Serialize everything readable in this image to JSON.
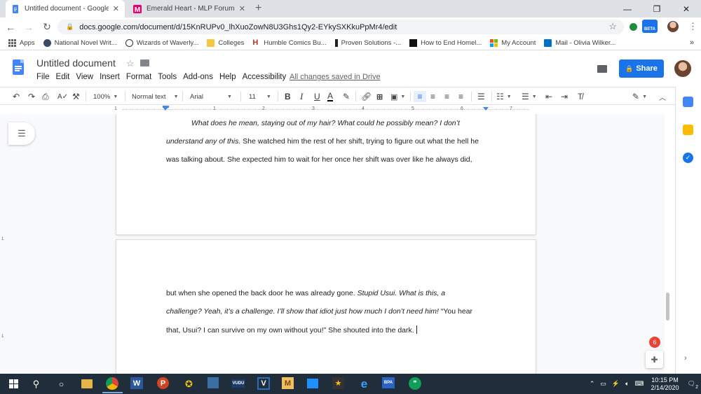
{
  "browser": {
    "tabs": [
      {
        "title": "Untitled document - Google Doc",
        "close": "✕"
      },
      {
        "title": "Emerald Heart - MLP Forums",
        "close": "✕"
      }
    ],
    "new_tab": "+",
    "window_controls": [
      "—",
      "❐",
      "✕"
    ],
    "url": "docs.google.com/document/d/15KnRUPv0_lhXuoZowN8U3Ghs1Qy2-EYkySXKkuPpMr4/edit",
    "extension_label": "BETA",
    "bookmarks": [
      "Apps",
      "National Novel Writ...",
      "Wizards of Waverly...",
      "Colleges",
      "Humble Comics Bu...",
      "Proven Solutions -...",
      "How to End Homel...",
      "My Account",
      "Mail - Olivia Wilker..."
    ],
    "bookmarks_more": "»",
    "colors": {
      "accent": "#1a73e8",
      "docs_blue": "#4285f4",
      "taskbar": "#1f2e3a"
    }
  },
  "docs": {
    "title": "Untitled document",
    "menus": [
      "File",
      "Edit",
      "View",
      "Insert",
      "Format",
      "Tools",
      "Add-ons",
      "Help",
      "Accessibility"
    ],
    "save_status": "All changes saved in Drive",
    "share_label": "Share",
    "toolbar": {
      "zoom": "100%",
      "style": "Normal text",
      "font": "Arial",
      "size": "11",
      "bold": "B",
      "italic": "I",
      "underline": "U",
      "text_color": "A"
    },
    "ruler_ticks": [
      "1",
      "1",
      "2",
      "3",
      "4",
      "5",
      "6",
      "7"
    ],
    "vertical_ruler": [
      "1",
      "1"
    ]
  },
  "document": {
    "page1_lines": [
      [
        {
          "t": "What does he mean, staying out of my hair? What could he possibly mean? I don’t",
          "i": true
        }
      ],
      [
        {
          "t": "understand any of this.",
          "i": true
        },
        {
          "t": " She watched him the rest of her shift, trying to figure out what the hell he",
          "i": false
        }
      ],
      [
        {
          "t": "was talking about. She expected him to wait for her once her shift was over like he always did,",
          "i": false
        }
      ]
    ],
    "page2_lines": [
      [
        {
          "t": "but when she opened the back door he was already gone. ",
          "i": false
        },
        {
          "t": "Stupid Usui. What is this, a",
          "i": true
        }
      ],
      [
        {
          "t": "challenge? Yeah, it’s a challenge. I’ll show that idiot just how much I don’t need him!",
          "i": true
        },
        {
          "t": " “You hear",
          "i": false
        }
      ],
      [
        {
          "t": "that, Usui? I can survive on my own without you!” She shouted into the dark.",
          "i": false
        }
      ]
    ]
  },
  "notifications": {
    "count": "6"
  },
  "taskbar": {
    "time": "10:15 PM",
    "date": "2/14/2020",
    "notification_count": "2"
  }
}
